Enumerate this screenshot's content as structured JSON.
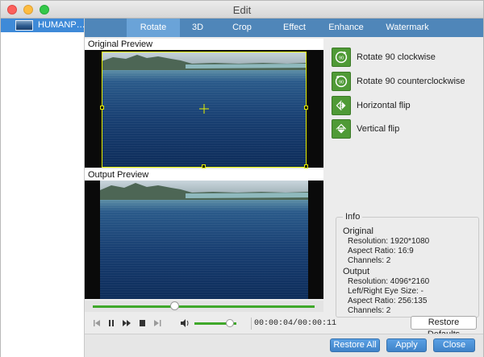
{
  "window": {
    "title": "Edit"
  },
  "file_list": [
    {
      "name": "HUMANP…"
    }
  ],
  "tabs": [
    {
      "label": "Rotate",
      "active": true
    },
    {
      "label": "3D",
      "active": false
    },
    {
      "label": "Crop",
      "active": false
    },
    {
      "label": "Effect",
      "active": false
    },
    {
      "label": "Enhance",
      "active": false
    },
    {
      "label": "Watermark",
      "active": false
    }
  ],
  "preview": {
    "original_label": "Original Preview",
    "output_label": "Output Preview"
  },
  "player": {
    "time": "00:00:04/00:00:11",
    "seek_progress": 0.37,
    "volume_level": 0.85
  },
  "rotate_options": [
    {
      "label": "Rotate 90 clockwise",
      "icon": "rotate-cw-90-icon"
    },
    {
      "label": "Rotate 90 counterclockwise",
      "icon": "rotate-ccw-90-icon"
    },
    {
      "label": "Horizontal flip",
      "icon": "horizontal-flip-icon"
    },
    {
      "label": "Vertical flip",
      "icon": "vertical-flip-icon"
    }
  ],
  "info": {
    "title": "Info",
    "original": {
      "heading": "Original",
      "resolution": "Resolution: 1920*1080",
      "aspect_ratio": "Aspect Ratio: 16:9",
      "channels": "Channels: 2"
    },
    "output": {
      "heading": "Output",
      "resolution": "Resolution: 4096*2160",
      "eye_size": "Left/Right Eye Size: -",
      "aspect_ratio": "Aspect Ratio: 256:135",
      "channels": "Channels: 2"
    }
  },
  "buttons": {
    "restore_defaults": "Restore Defaults",
    "restore_all": "Restore All",
    "apply": "Apply",
    "close": "Close"
  },
  "colors": {
    "tab_bar": "#4f86b9",
    "tab_active": "#6aa3d8",
    "accent_green": "#4f9a36",
    "crop_frame": "#e6f000"
  }
}
